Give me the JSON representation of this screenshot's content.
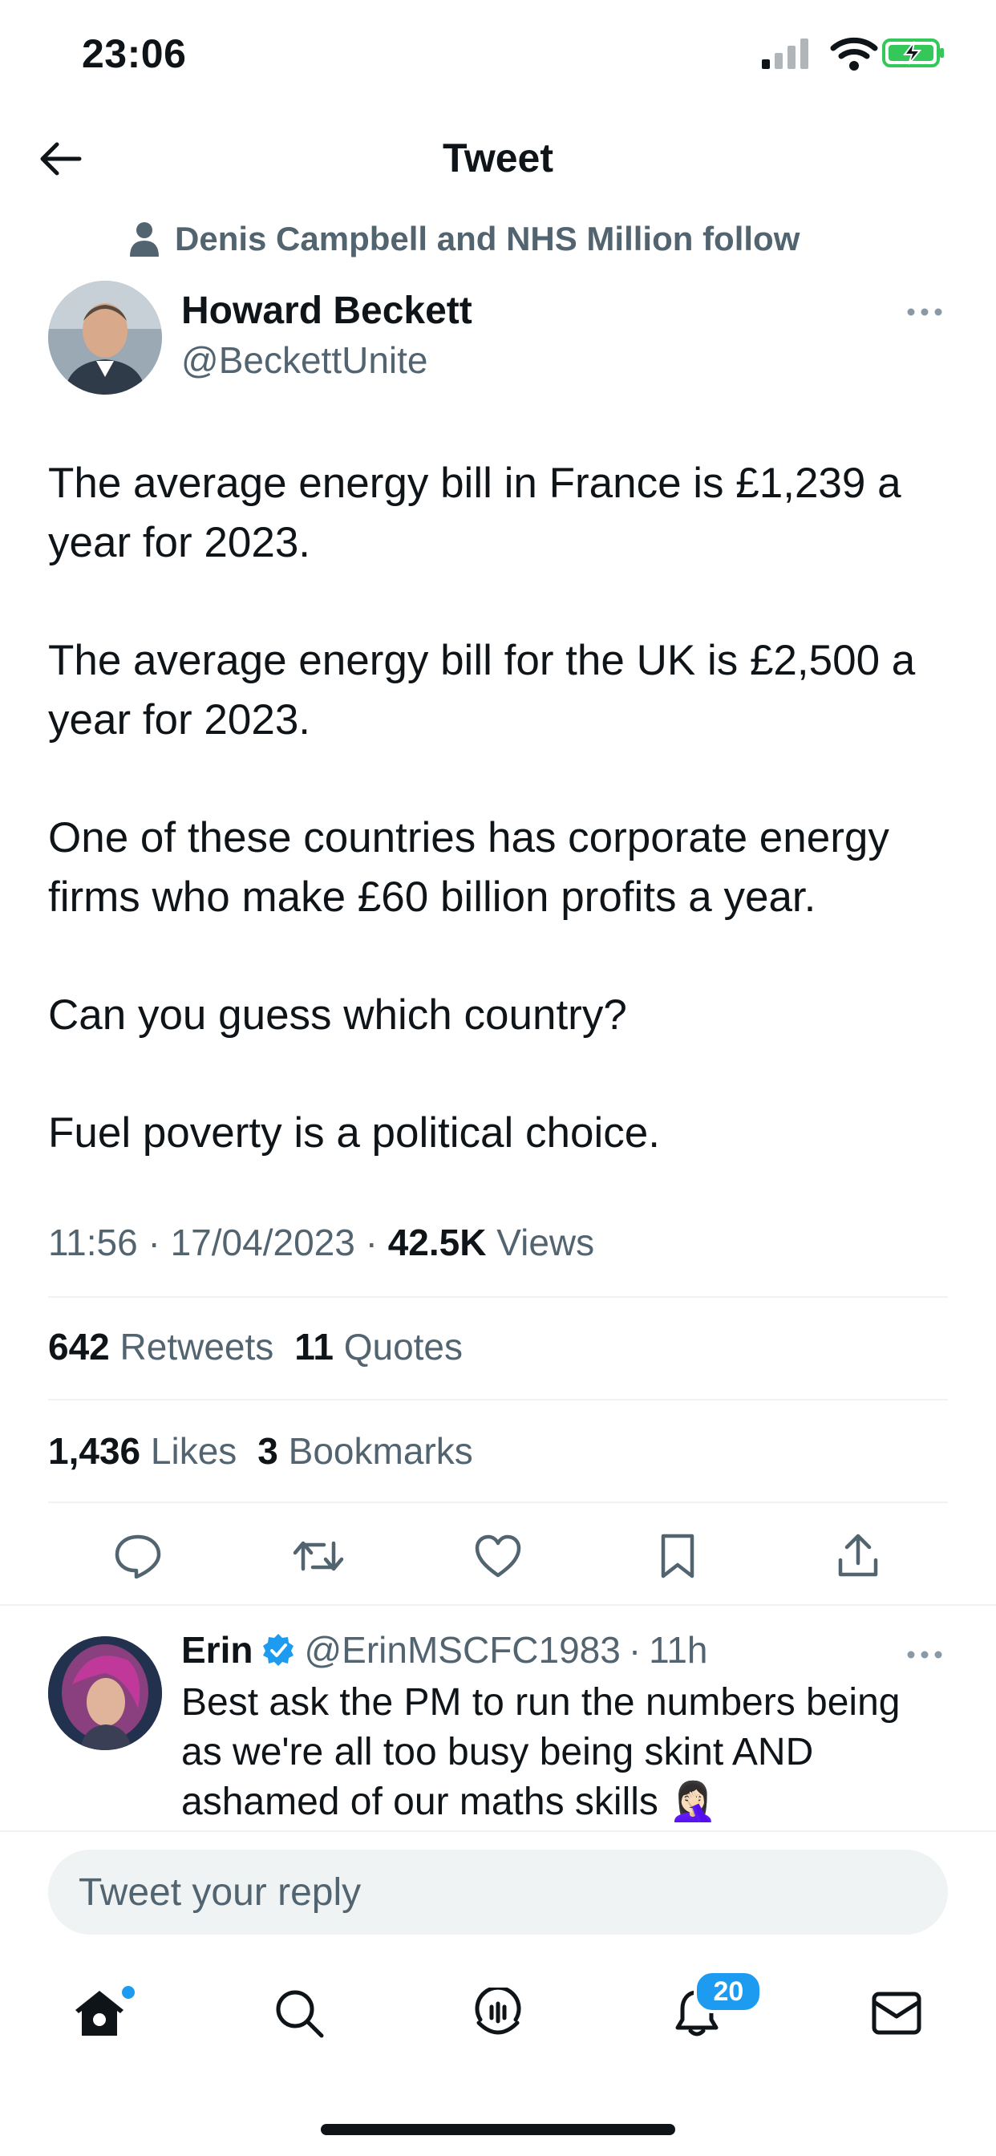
{
  "status_bar": {
    "time": "23:06",
    "battery_color": "#34c759"
  },
  "header": {
    "title": "Tweet"
  },
  "social_context": {
    "text": "Denis Campbell and NHS Million follow"
  },
  "tweet": {
    "author_name": "Howard Beckett",
    "author_handle": "@BeckettUnite",
    "paragraphs": [
      "The average energy bill in France is £1,239 a year for 2023.",
      "The average energy bill for the UK is £2,500 a year for 2023.",
      "One of these countries has corporate energy firms who make £60 billion profits a year.",
      "Can you guess which country?",
      "Fuel poverty is a political choice."
    ],
    "time": "11:56",
    "date": "17/04/2023",
    "views_count": "42.5K",
    "views_label": "Views",
    "retweets_count": "642",
    "retweets_label": "Retweets",
    "quotes_count": "11",
    "quotes_label": "Quotes",
    "likes_count": "1,436",
    "likes_label": "Likes",
    "bookmarks_count": "3",
    "bookmarks_label": "Bookmarks"
  },
  "actions": [
    {
      "name": "reply-icon"
    },
    {
      "name": "retweet-icon"
    },
    {
      "name": "like-icon"
    },
    {
      "name": "bookmark-icon"
    },
    {
      "name": "share-icon"
    }
  ],
  "reply": {
    "name": "Erin",
    "handle": "@ErinMSCFC1983",
    "age": "11h",
    "text": "Best ask the PM to run the numbers being as we're all too busy being skint AND ashamed of our maths skills 🤦🏻‍♀️",
    "verified_color": "#1d9bf0"
  },
  "compose": {
    "placeholder": "Tweet your reply"
  },
  "tabbar": {
    "items": [
      "home-icon",
      "search-icon",
      "spaces-icon",
      "notifications-icon",
      "messages-icon"
    ],
    "notifications_badge": "20"
  },
  "colors": {
    "accent": "#1d9bf0",
    "secondary_text": "#536471",
    "divider": "#eff3f4"
  }
}
